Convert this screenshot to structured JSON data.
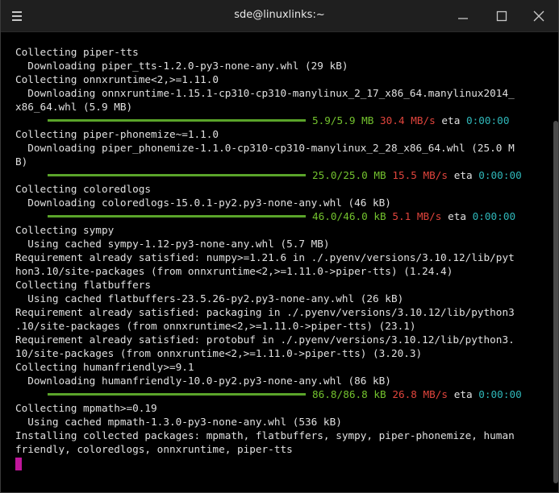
{
  "window": {
    "title": "sde@linuxlinks:~",
    "menu_icon": "hamburger-menu-icon",
    "controls": [
      "minimize-icon",
      "maximize-icon",
      "close-icon"
    ]
  },
  "terminal": {
    "lines": [
      {
        "t": "Collecting piper-tts"
      },
      {
        "t": "  Downloading piper_tts-1.2.0-py3-none-any.whl (29 kB)"
      },
      {
        "t": "Collecting onnxruntime<2,>=1.11.0"
      },
      {
        "t": "  Downloading onnxruntime-1.15.1-cp310-cp310-manylinux_2_17_x86_64.manylinux2014_"
      },
      {
        "t": "x86_64.whl (5.9 MB)"
      },
      {
        "progress": {
          "size": "5.9/5.9 MB",
          "speed": "30.4 MB/s",
          "eta_label": "eta",
          "eta": "0:00:00",
          "fraction": 1.0
        }
      },
      {
        "t": "Collecting piper-phonemize~=1.1.0"
      },
      {
        "t": "  Downloading piper_phonemize-1.1.0-cp310-cp310-manylinux_2_28_x86_64.whl (25.0 M"
      },
      {
        "t": "B)"
      },
      {
        "progress": {
          "size": "25.0/25.0 MB",
          "speed": "15.5 MB/s",
          "eta_label": "eta",
          "eta": "0:00:00",
          "fraction": 1.0
        }
      },
      {
        "t": "Collecting coloredlogs"
      },
      {
        "t": "  Downloading coloredlogs-15.0.1-py2.py3-none-any.whl (46 kB)"
      },
      {
        "progress": {
          "size": "46.0/46.0 kB",
          "speed": "5.1 MB/s",
          "eta_label": "eta",
          "eta": "0:00:00",
          "fraction": 1.0
        }
      },
      {
        "t": "Collecting sympy"
      },
      {
        "t": "  Using cached sympy-1.12-py3-none-any.whl (5.7 MB)"
      },
      {
        "t": "Requirement already satisfied: numpy>=1.21.6 in ./.pyenv/versions/3.10.12/lib/pyt"
      },
      {
        "t": "hon3.10/site-packages (from onnxruntime<2,>=1.11.0->piper-tts) (1.24.4)"
      },
      {
        "t": "Collecting flatbuffers"
      },
      {
        "t": "  Using cached flatbuffers-23.5.26-py2.py3-none-any.whl (26 kB)"
      },
      {
        "t": "Requirement already satisfied: packaging in ./.pyenv/versions/3.10.12/lib/python3"
      },
      {
        "t": ".10/site-packages (from onnxruntime<2,>=1.11.0->piper-tts) (23.1)"
      },
      {
        "t": "Requirement already satisfied: protobuf in ./.pyenv/versions/3.10.12/lib/python3."
      },
      {
        "t": "10/site-packages (from onnxruntime<2,>=1.11.0->piper-tts) (3.20.3)"
      },
      {
        "t": "Collecting humanfriendly>=9.1"
      },
      {
        "t": "  Downloading humanfriendly-10.0-py2.py3-none-any.whl (86 kB)"
      },
      {
        "progress": {
          "size": "86.8/86.8 kB",
          "speed": "26.8 MB/s",
          "eta_label": "eta",
          "eta": "0:00:00",
          "fraction": 1.0
        }
      },
      {
        "t": "Collecting mpmath>=0.19"
      },
      {
        "t": "  Using cached mpmath-1.3.0-py3-none-any.whl (536 kB)"
      },
      {
        "t": "Installing collected packages: mpmath, flatbuffers, sympy, piper-phonemize, human"
      },
      {
        "t": "friendly, coloredlogs, onnxruntime, piper-tts"
      },
      {
        "cursor": true
      }
    ]
  },
  "colors": {
    "progress_bar": "#5aa42a",
    "size_text": "#73c22e",
    "speed_text": "#e0443c",
    "eta_text": "#2fb7b9",
    "cursor": "#c0169b"
  }
}
